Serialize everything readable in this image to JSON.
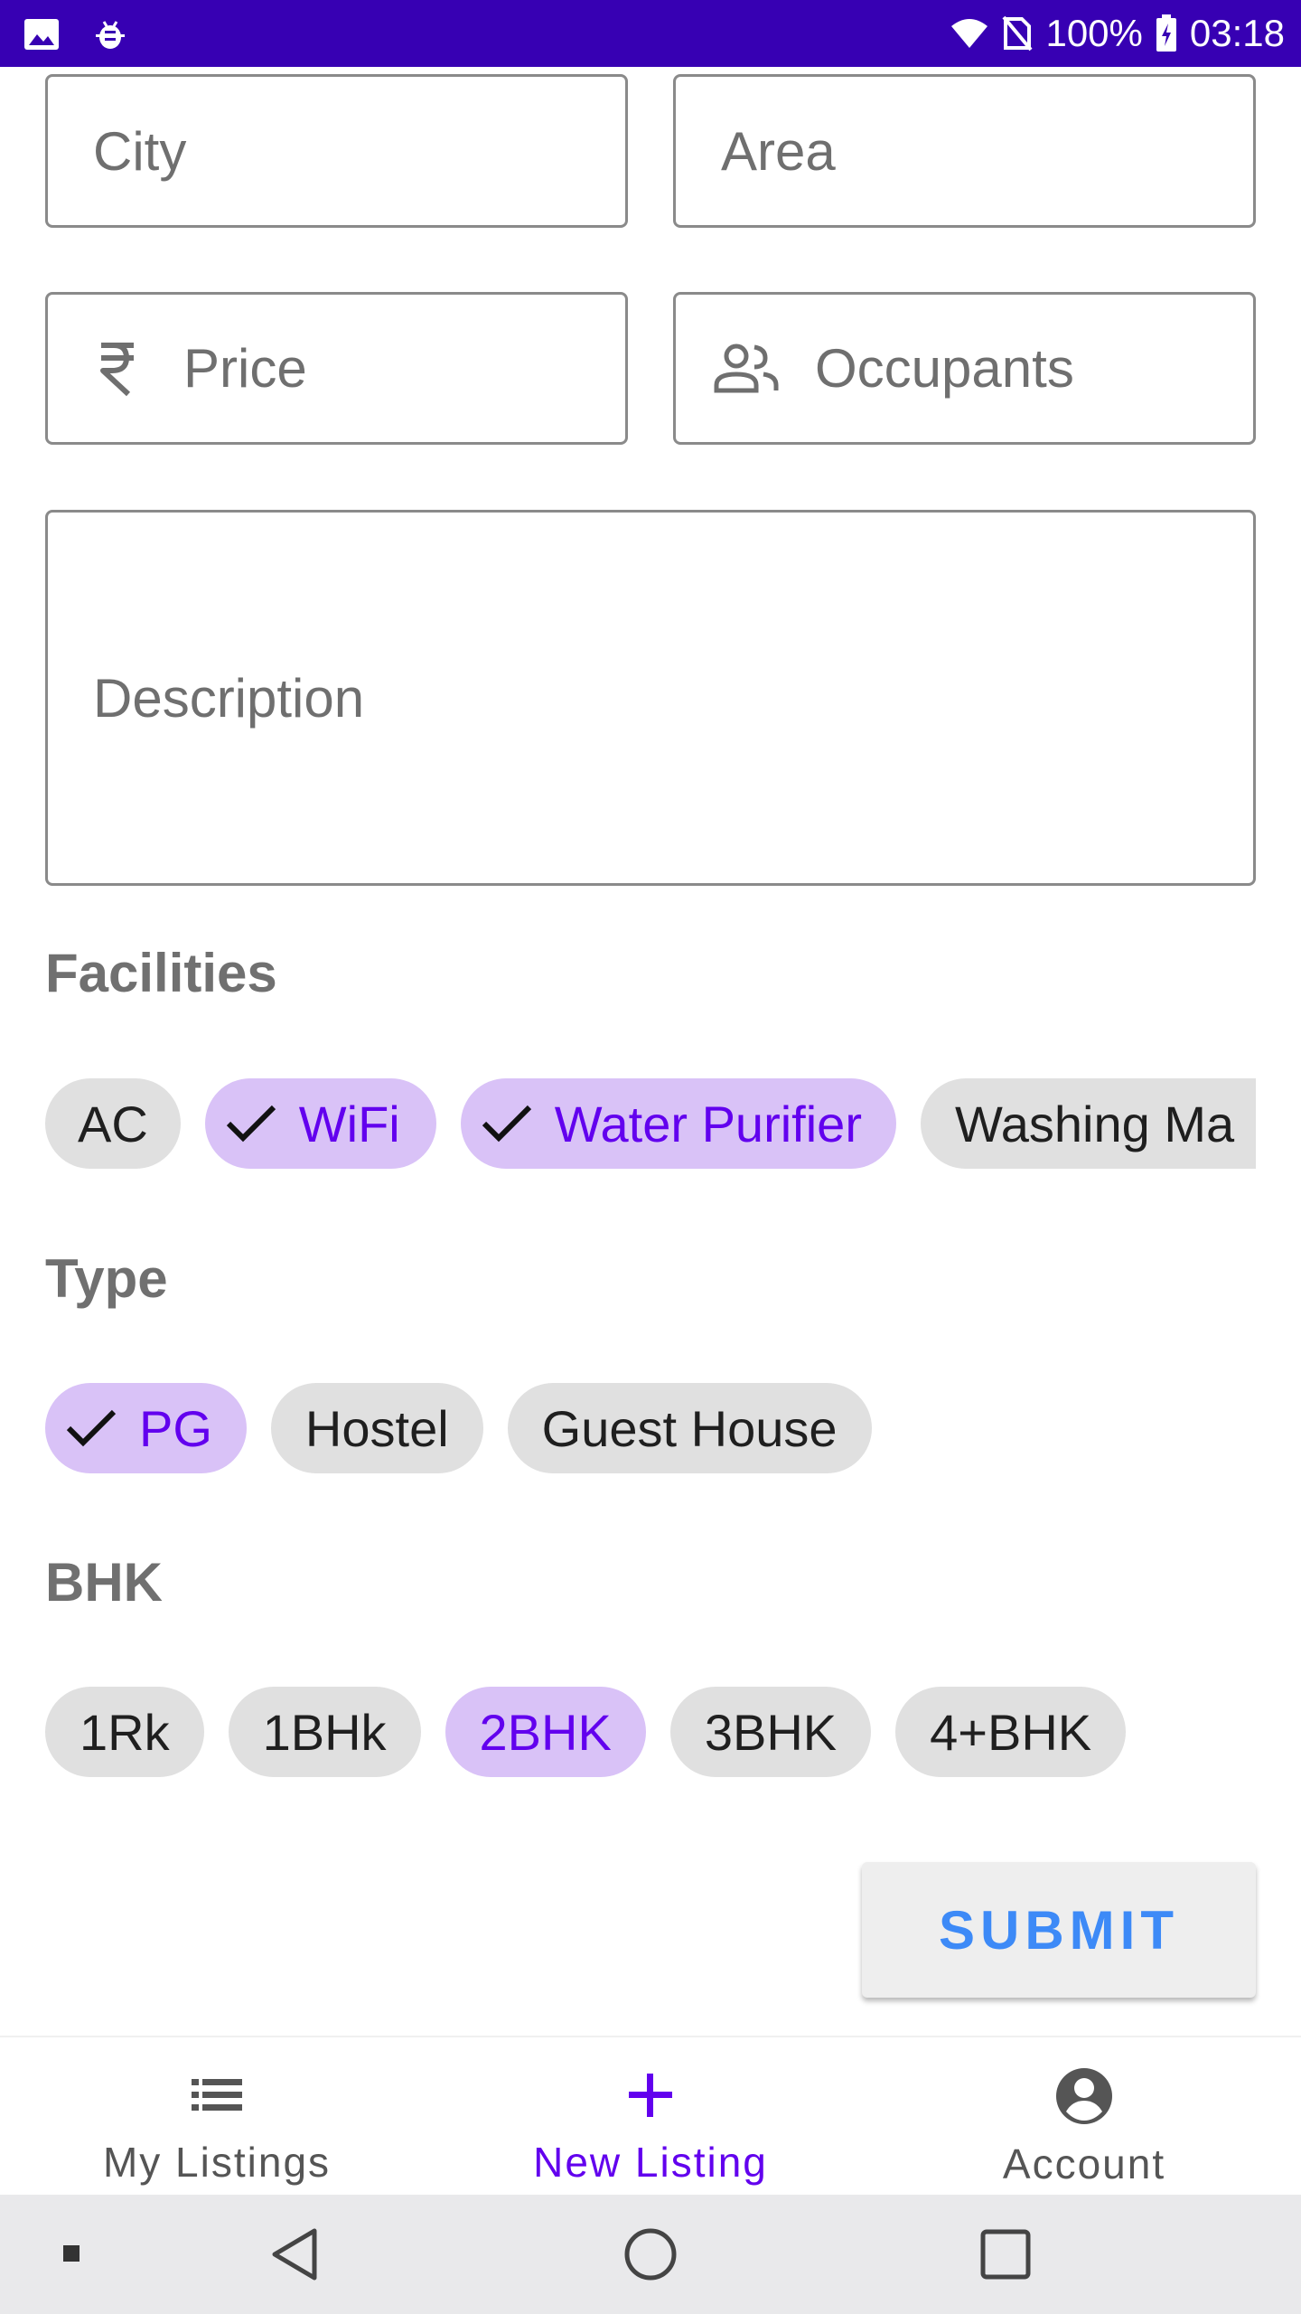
{
  "status_bar": {
    "battery": "100%",
    "time": "03:18",
    "icons": [
      "image-icon",
      "android-debug-icon",
      "wifi-icon",
      "no-sim-icon",
      "battery-charging-icon"
    ]
  },
  "form": {
    "city": {
      "placeholder": "City",
      "value": ""
    },
    "area": {
      "placeholder": "Area",
      "value": ""
    },
    "price": {
      "placeholder": "Price",
      "value": "",
      "icon": "rupee-icon"
    },
    "occupants": {
      "placeholder": "Occupants",
      "value": "",
      "icon": "people-icon"
    },
    "description": {
      "placeholder": "Description",
      "value": ""
    }
  },
  "facilities": {
    "label": "Facilities",
    "chips": [
      {
        "label": "AC",
        "selected": false
      },
      {
        "label": "WiFi",
        "selected": true
      },
      {
        "label": "Water Purifier",
        "selected": true
      },
      {
        "label": "Washing Ma",
        "selected": false
      }
    ]
  },
  "type": {
    "label": "Type",
    "chips": [
      {
        "label": "PG",
        "selected": true
      },
      {
        "label": "Hostel",
        "selected": false
      },
      {
        "label": "Guest House",
        "selected": false
      }
    ]
  },
  "bhk": {
    "label": "BHK",
    "chips": [
      {
        "label": "1Rk",
        "selected": false
      },
      {
        "label": "1BHk",
        "selected": false
      },
      {
        "label": "2BHK",
        "selected": true
      },
      {
        "label": "3BHK",
        "selected": false
      },
      {
        "label": "4+BHK",
        "selected": false
      }
    ]
  },
  "submit_label": "SUBMIT",
  "bottom_nav": {
    "items": [
      {
        "label": "My Listings",
        "icon": "list-icon",
        "active": false
      },
      {
        "label": "New Listing",
        "icon": "plus-icon",
        "active": true
      },
      {
        "label": "Account",
        "icon": "account-circle-icon",
        "active": false
      }
    ]
  },
  "colors": {
    "status_bar": "#3700b3",
    "primary": "#6200ee",
    "chip_selected_bg": "#d9c2f7",
    "chip_bg": "#e0e0e0",
    "submit_text": "#3d8af7"
  }
}
